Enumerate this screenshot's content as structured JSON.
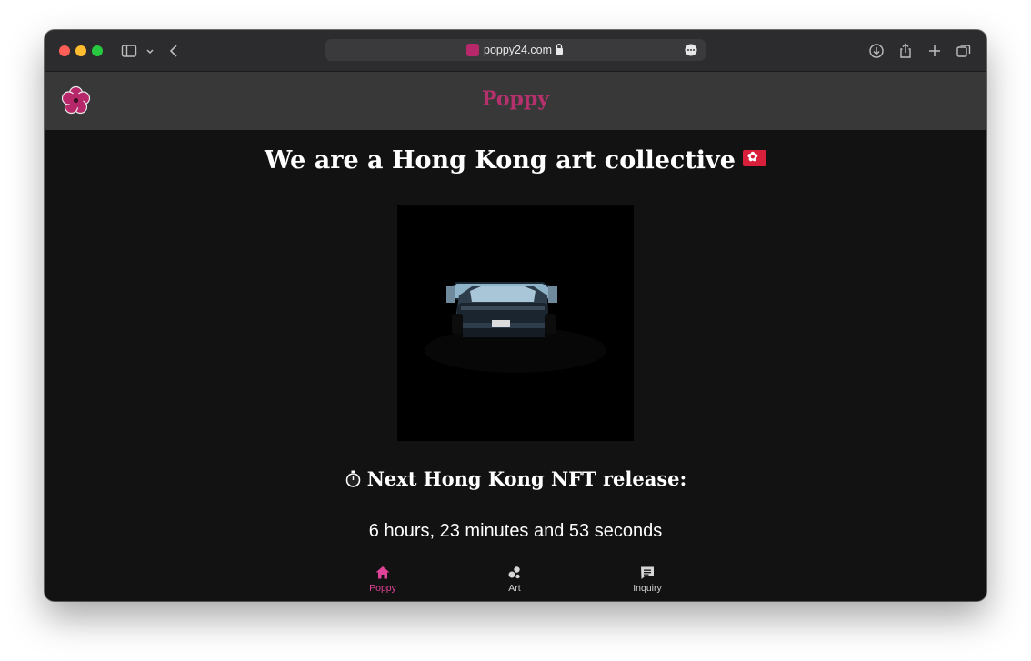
{
  "browser": {
    "url": "poppy24.com",
    "icons": [
      "sidebar-icon",
      "chevron-down-icon",
      "back-icon",
      "lock-icon",
      "more-icon",
      "download-icon",
      "share-icon",
      "new-tab-icon",
      "tabs-overview-icon"
    ]
  },
  "header": {
    "brand": "Poppy",
    "brand_color": "#b5316e",
    "logo_icon": "poppy-flower-icon"
  },
  "main": {
    "headline": "We are a Hong Kong art collective",
    "headline_flag": "hong-kong-flag-icon",
    "image_alt": "rear view of a dark supercar",
    "release_label": "Next Hong Kong NFT release:",
    "release_icon": "stopwatch-icon",
    "countdown": "6 hours, 23 minutes and 53 seconds"
  },
  "bottom_nav": {
    "accent_color": "#e0449a",
    "items": [
      {
        "label": "Poppy",
        "icon": "home-icon",
        "active": true
      },
      {
        "label": "Art",
        "icon": "art-icon",
        "active": false
      },
      {
        "label": "Inquiry",
        "icon": "chat-icon",
        "active": false
      }
    ]
  }
}
